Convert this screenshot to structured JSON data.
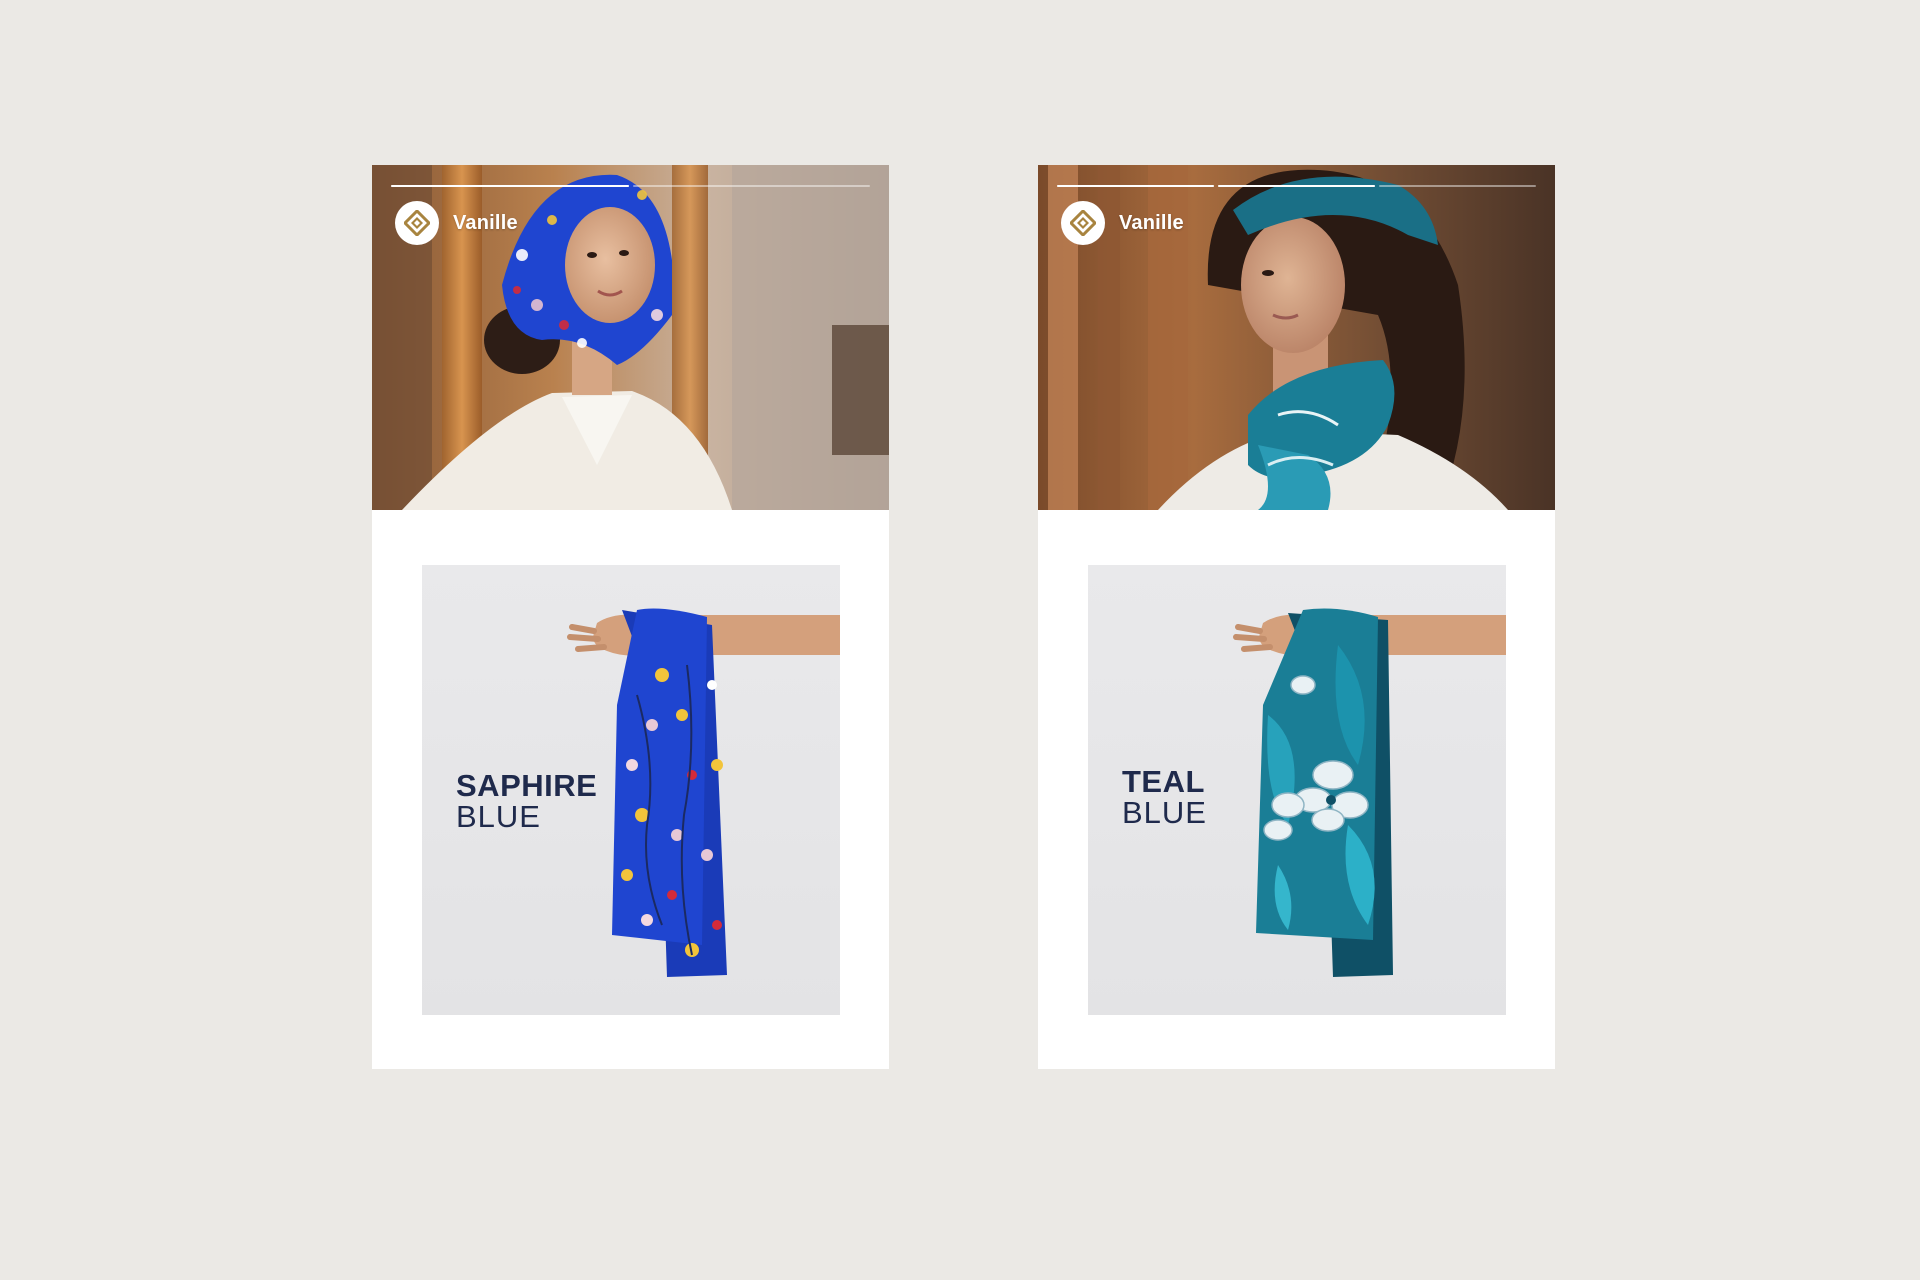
{
  "colors": {
    "background": "#ebe9e5",
    "card": "#ffffff",
    "panel": "#e6e6e8",
    "text_dark": "#1f2a4c",
    "brand_gold": "#a8843f",
    "saphire_scarf": "#1f45d0",
    "teal_scarf": "#1a7e96"
  },
  "cards": [
    {
      "brand": {
        "name": "Vanille",
        "logo_icon": "diamond-logo-icon"
      },
      "story_progress": [
        1,
        0
      ],
      "hero_image": "woman-in-blue-floral-headscarf-photo",
      "product": {
        "color_line1": "SAPHIRE",
        "color_line2": "BLUE",
        "image": "saphire-blue-floral-scarf-on-arm"
      }
    },
    {
      "brand": {
        "name": "Vanille",
        "logo_icon": "diamond-logo-icon"
      },
      "story_progress": [
        1,
        1,
        0
      ],
      "hero_image": "woman-in-teal-scarf-photo",
      "product": {
        "color_line1": "TEAL",
        "color_line2": "BLUE",
        "image": "teal-blue-tropical-scarf-on-arm"
      }
    }
  ]
}
